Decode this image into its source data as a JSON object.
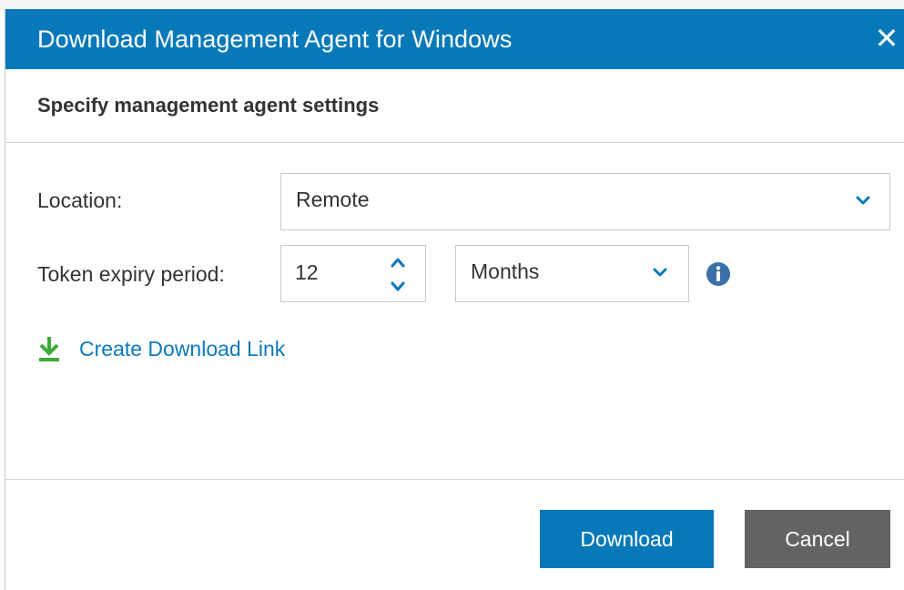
{
  "dialog": {
    "title": "Download Management Agent for Windows",
    "close_glyph": "✕",
    "section_title": "Specify management agent settings"
  },
  "form": {
    "location_label": "Location:",
    "location_value": "Remote",
    "token_label": "Token expiry period:",
    "token_value": "12",
    "period_value": "Months",
    "info_icon": "info-icon"
  },
  "link": {
    "text": "Create Download Link",
    "icon": "download-icon"
  },
  "buttons": {
    "download": "Download",
    "cancel": "Cancel"
  },
  "colors": {
    "titlebar": "#0779b9",
    "primary_button": "#0779b9",
    "cancel_button": "#636363",
    "link": "#0b7ab8",
    "download_icon": "#3daa3a"
  }
}
